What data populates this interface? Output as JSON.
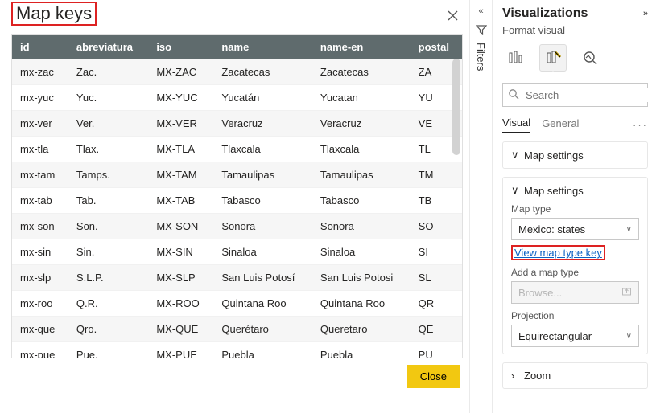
{
  "dialog": {
    "title": "Map keys",
    "close_label": "Close"
  },
  "table": {
    "columns": [
      "id",
      "abreviatura",
      "iso",
      "name",
      "name-en",
      "postal"
    ],
    "rows": [
      {
        "id": "mx-zac",
        "abreviatura": "Zac.",
        "iso": "MX-ZAC",
        "name": "Zacatecas",
        "name_en": "Zacatecas",
        "postal": "ZA"
      },
      {
        "id": "mx-yuc",
        "abreviatura": "Yuc.",
        "iso": "MX-YUC",
        "name": "Yucatán",
        "name_en": "Yucatan",
        "postal": "YU"
      },
      {
        "id": "mx-ver",
        "abreviatura": "Ver.",
        "iso": "MX-VER",
        "name": "Veracruz",
        "name_en": "Veracruz",
        "postal": "VE"
      },
      {
        "id": "mx-tla",
        "abreviatura": "Tlax.",
        "iso": "MX-TLA",
        "name": "Tlaxcala",
        "name_en": "Tlaxcala",
        "postal": "TL"
      },
      {
        "id": "mx-tam",
        "abreviatura": "Tamps.",
        "iso": "MX-TAM",
        "name": "Tamaulipas",
        "name_en": "Tamaulipas",
        "postal": "TM"
      },
      {
        "id": "mx-tab",
        "abreviatura": "Tab.",
        "iso": "MX-TAB",
        "name": "Tabasco",
        "name_en": "Tabasco",
        "postal": "TB"
      },
      {
        "id": "mx-son",
        "abreviatura": "Son.",
        "iso": "MX-SON",
        "name": "Sonora",
        "name_en": "Sonora",
        "postal": "SO"
      },
      {
        "id": "mx-sin",
        "abreviatura": "Sin.",
        "iso": "MX-SIN",
        "name": "Sinaloa",
        "name_en": "Sinaloa",
        "postal": "SI"
      },
      {
        "id": "mx-slp",
        "abreviatura": "S.L.P.",
        "iso": "MX-SLP",
        "name": "San Luis Potosí",
        "name_en": "San Luis Potosi",
        "postal": "SL"
      },
      {
        "id": "mx-roo",
        "abreviatura": "Q.R.",
        "iso": "MX-ROO",
        "name": "Quintana Roo",
        "name_en": "Quintana Roo",
        "postal": "QR"
      },
      {
        "id": "mx-que",
        "abreviatura": "Qro.",
        "iso": "MX-QUE",
        "name": "Querétaro",
        "name_en": "Queretaro",
        "postal": "QE"
      },
      {
        "id": "mx-pue",
        "abreviatura": "Pue.",
        "iso": "MX-PUE",
        "name": "Puebla",
        "name_en": "Puebla",
        "postal": "PU"
      }
    ]
  },
  "filters_rail": {
    "label": "Filters"
  },
  "vis": {
    "title": "Visualizations",
    "subtitle": "Format visual",
    "search_placeholder": "Search",
    "inner_tabs": {
      "visual": "Visual",
      "general": "General"
    },
    "cards": {
      "map_settings_outer": "Map settings",
      "map_settings_inner": "Map settings",
      "map_type_label": "Map type",
      "map_type_value": "Mexico: states",
      "view_key_link": "View map type key",
      "add_map_type_label": "Add a map type",
      "browse_placeholder": "Browse...",
      "projection_label": "Projection",
      "projection_value": "Equirectangular",
      "zoom_label": "Zoom"
    }
  }
}
